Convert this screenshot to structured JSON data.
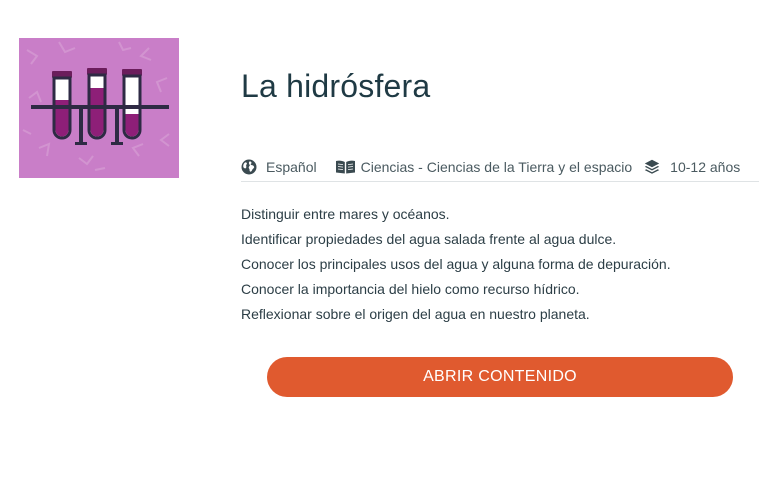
{
  "resource": {
    "title": "La hidrósfera",
    "thumbnail_icon": "test-tubes-rack-icon",
    "thumbnail_background": "#c97ec8"
  },
  "meta": {
    "language_icon": "globe-icon",
    "language": "Español",
    "subject_icon": "open-book-icon",
    "subject": "Ciencias - Ciencias de la Tierra y el espacio",
    "age_icon": "layers-icon",
    "age_range": "10-12 años"
  },
  "objectives": [
    "Distinguir entre mares y océanos.",
    "Identificar propiedades del agua salada frente al agua dulce.",
    "Conocer los principales usos del agua y alguna forma de depuración.",
    "Conocer la importancia del hielo como recurso hídrico.",
    "Reflexionar sobre el origen del agua en nuestro planeta."
  ],
  "actions": {
    "open_label": "ABRIR CONTENIDO",
    "open_color": "#e05a2f"
  }
}
